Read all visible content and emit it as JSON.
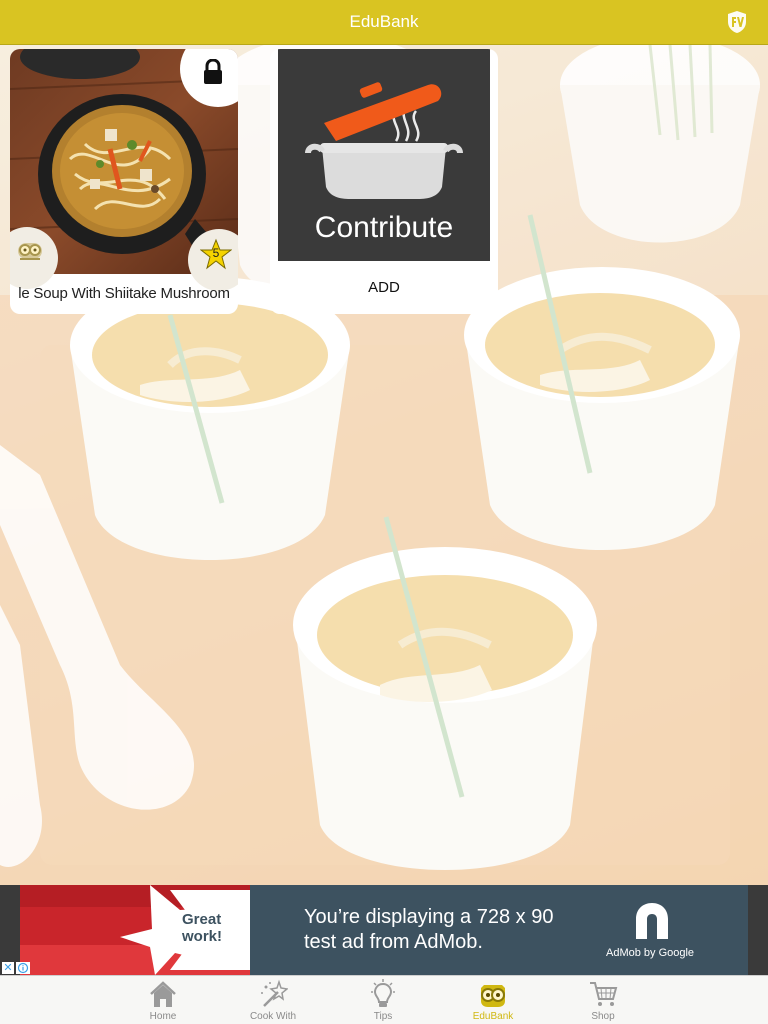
{
  "header": {
    "title": "EduBank"
  },
  "cards": [
    {
      "type": "recipe",
      "title": "le Soup With Shiitake Mushroom",
      "rating": "5"
    },
    {
      "type": "contribute",
      "image_text": "Contribute",
      "label": "ADD"
    }
  ],
  "ad": {
    "headline": "Great work!",
    "headline_line1": "Great",
    "headline_line2": "work!",
    "text_line1": "You’re displaying a 728 x 90",
    "text_line2": "test ad from AdMob.",
    "brand": "AdMob by Google",
    "close_glyph": "✕"
  },
  "tabbar": {
    "active": "EduBank",
    "tabs": [
      {
        "label": "Home",
        "icon": "home-icon"
      },
      {
        "label": "Cook With",
        "icon": "magic-wand-icon"
      },
      {
        "label": "Tips",
        "icon": "lightbulb-icon"
      },
      {
        "label": "EduBank",
        "icon": "owl-glasses-icon"
      },
      {
        "label": "Shop",
        "icon": "shopping-cart-icon"
      }
    ]
  },
  "colors": {
    "header": "#d9c422",
    "active_tab": "#d0b812",
    "ad_background": "#3d5260",
    "contribute_background": "#3a3a3a",
    "pot_lid": "#f05a1a"
  }
}
